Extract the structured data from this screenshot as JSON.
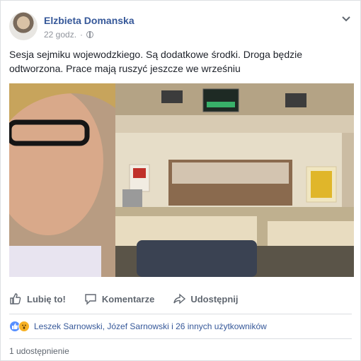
{
  "post": {
    "author": "Elzbieta Domanska",
    "time": "22 godz.",
    "privacy_icon": "globe-icon",
    "text": "Sesja sejmiku wojewodzkiego. Są dodatkowe środki. Droga będzie odtworzona. Prace mają ruszyć jeszcze we wrześniu"
  },
  "actions": {
    "like_label": "Lubię to!",
    "comment_label": "Komentarze",
    "share_label": "Udostępnij"
  },
  "reactions": {
    "text": "Leszek Sarnowski, Józef Sarnowski i 26 innych użytkowników",
    "icons": [
      "like-icon",
      "wow-icon"
    ]
  },
  "shares": {
    "text": "1 udostępnienie"
  },
  "colors": {
    "link": "#365899",
    "action": "#606770",
    "like_blue": "#5890ff",
    "wow_yellow": "#f7b125"
  }
}
